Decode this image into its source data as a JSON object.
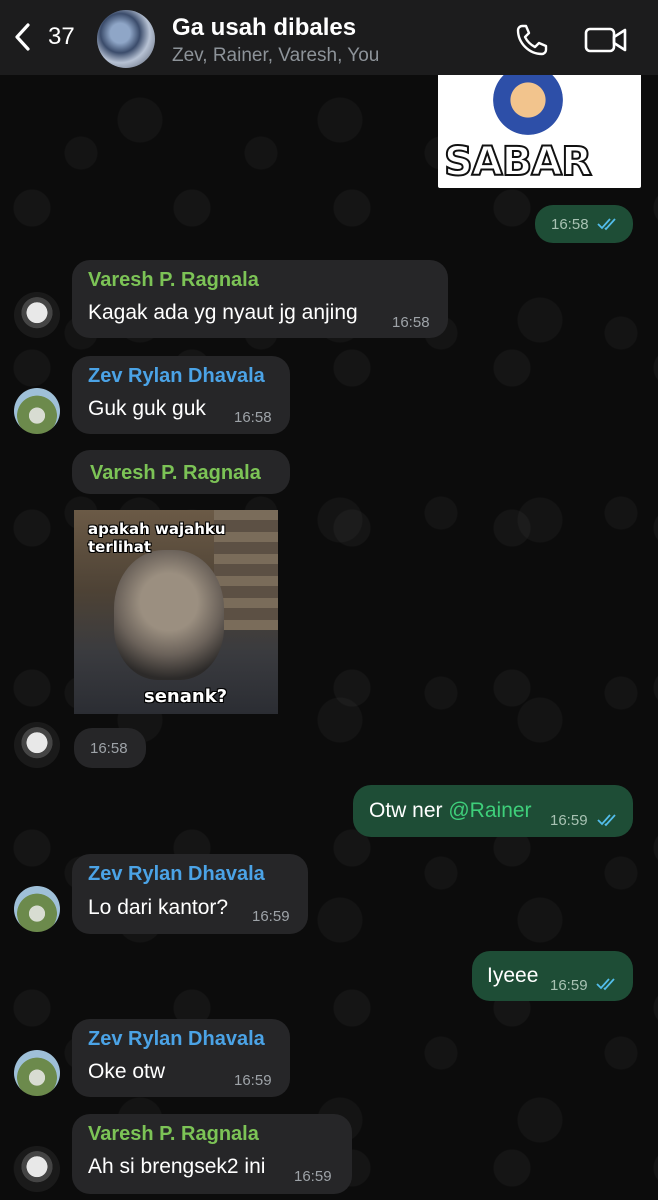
{
  "header": {
    "back_count": "37",
    "title": "Ga usah dibales",
    "members": "Zev, Rainer, Varesh, You"
  },
  "messages": [
    {
      "type": "out-image",
      "image": "sabar-sticker",
      "caption": "SABAR",
      "time": "16:58"
    },
    {
      "type": "in",
      "sender": "Varesh P. Ragnala",
      "text": "Kagak ada yg nyaut jg anjing",
      "time": "16:58"
    },
    {
      "type": "in",
      "sender": "Zev Rylan Dhavala",
      "text": "Guk guk guk",
      "time": "16:58"
    },
    {
      "type": "in-image",
      "sender": "Varesh P. Ragnala",
      "meme_top": "apakah wajahku terlihat",
      "meme_bottom": "senank?",
      "time": "16:58"
    },
    {
      "type": "out",
      "text": "Otw ner ",
      "mention": "@Rainer",
      "time": "16:59"
    },
    {
      "type": "in",
      "sender": "Zev Rylan Dhavala",
      "text": "Lo dari kantor?",
      "time": "16:59"
    },
    {
      "type": "out",
      "text": "Iyeee",
      "time": "16:59"
    },
    {
      "type": "in",
      "sender": "Zev Rylan Dhavala",
      "text": "Oke otw",
      "time": "16:59"
    },
    {
      "type": "in",
      "sender": "Varesh P. Ragnala",
      "text": "Ah si brengsek2 ini",
      "time": "16:59"
    }
  ],
  "colors": {
    "sender_varesh": "#7cc356",
    "sender_zev": "#4ba3e6",
    "outgoing_bubble": "#1e4d36",
    "incoming_bubble": "#262628",
    "mention": "#3ecf7a",
    "read_ticks": "#53bdeb"
  },
  "icons": [
    "chevron-left-icon",
    "phone-icon",
    "video-camera-icon",
    "double-check-icon"
  ]
}
